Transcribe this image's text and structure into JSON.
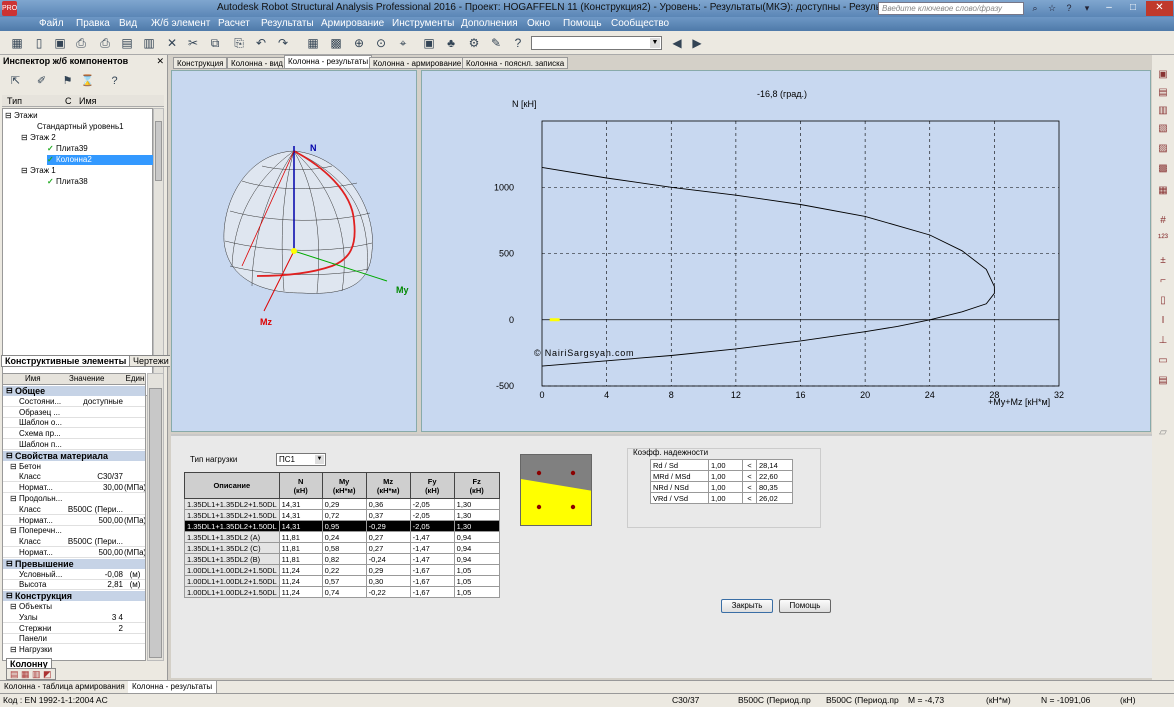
{
  "titlebar": {
    "title": "Autodesk Robot Structural Analysis Professional 2016 - Проект: HOGAFFELN 11 (Конструкция2) - Уровень:  - Результаты(МКЭ): доступны - Результаты: доступные",
    "logo": "PRO",
    "search_placeholder": "Введите ключевое слово/фразу"
  },
  "menu": [
    "Файл",
    "Правка",
    "Вид",
    "Ж/б элемент",
    "Расчет",
    "Результаты",
    "Армирование",
    "Инструменты",
    "Дополнения",
    "Окно",
    "Помощь",
    "Сообщество"
  ],
  "inspector": {
    "title": "Инспектор ж/б компонентов",
    "columns": {
      "type": "Тип",
      "c": "С",
      "name": "Имя"
    },
    "tree": {
      "floors": "Этажи",
      "std_level": "Стандартный уровень1",
      "floor2": "Этаж 2",
      "slab39": "Плита39",
      "column2": "Колонна2",
      "floor1": "Этаж 1",
      "slab38": "Плита38"
    },
    "tabs": {
      "elements": "Конструктивные элементы",
      "drawings": "Чертежи"
    }
  },
  "properties": {
    "columns": {
      "name": "Имя",
      "value": "Значение",
      "unit": "Един"
    },
    "rows": [
      {
        "group": "Общее"
      },
      {
        "name": "Состояни...",
        "value": "доступные",
        "unit": ""
      },
      {
        "name": "Образец ...",
        "value": "",
        "unit": ""
      },
      {
        "name": "Шаблон о...",
        "value": "",
        "unit": ""
      },
      {
        "name": "Схема пр...",
        "value": "",
        "unit": ""
      },
      {
        "name": "Шаблон п...",
        "value": "",
        "unit": ""
      },
      {
        "group": "Свойства материала"
      },
      {
        "sub": "Бетон"
      },
      {
        "name": "Класс",
        "value": "C30/37",
        "unit": ""
      },
      {
        "name": "Нормат...",
        "value": "30,00",
        "unit": "(MПa)"
      },
      {
        "sub": "Продольн..."
      },
      {
        "name": "Класс",
        "value": "B500C (Пери...",
        "unit": ""
      },
      {
        "name": "Нормат...",
        "value": "500,00",
        "unit": "(MПa)"
      },
      {
        "sub": "Поперечн..."
      },
      {
        "name": "Класс",
        "value": "B500C (Пери...",
        "unit": ""
      },
      {
        "name": "Нормат...",
        "value": "500,00",
        "unit": "(MПa)"
      },
      {
        "group": "Превышение"
      },
      {
        "name": "Условный...",
        "value": "-0,08",
        "unit": "(м)"
      },
      {
        "name": "Высота",
        "value": "2,81",
        "unit": "(м)"
      },
      {
        "group": "Конструкция"
      },
      {
        "sub": "Объекты"
      },
      {
        "name": "Узлы",
        "value": "3 4",
        "unit": ""
      },
      {
        "name": "Стержни",
        "value": "2",
        "unit": ""
      },
      {
        "name": "Панели",
        "value": "",
        "unit": ""
      },
      {
        "sub": "Нагрузки"
      }
    ],
    "bottom_tab": "Колонну"
  },
  "doc_tabs": [
    "Конструкция",
    "Колонна - вид",
    "Колонна - результаты",
    "Колонна - армирование",
    "Колонна - пояснл. записка"
  ],
  "view3d": {
    "axis_n": "N",
    "axis_my": "My",
    "axis_mz": "Mz"
  },
  "chart_data": {
    "type": "line",
    "title": "-16,8 (град.)",
    "ylabel": "N [кН]",
    "xlabel": "+My+Mz [кН*м]",
    "xlim": [
      0,
      32
    ],
    "ylim": [
      -500,
      1500
    ],
    "xticks": [
      0,
      4,
      8,
      12,
      16,
      20,
      24,
      28,
      32
    ],
    "yticks": [
      {
        "v": 1000,
        "l": "1000"
      },
      {
        "v": 500,
        "l": "500"
      },
      {
        "v": 0,
        "l": "0"
      },
      {
        "v": -500,
        "l": "-500"
      }
    ],
    "watermark": "© NairiSargsyan.com",
    "series": [
      {
        "x": [
          0,
          4,
          8,
          12,
          16,
          20,
          24,
          26,
          27.5,
          28,
          28,
          27.5,
          26,
          24,
          22,
          20,
          16,
          12,
          8,
          4,
          0
        ],
        "y": [
          1150,
          1070,
          1000,
          940,
          870,
          780,
          640,
          520,
          380,
          250,
          200,
          120,
          60,
          0,
          -50,
          -90,
          -160,
          -220,
          -270,
          -310,
          -350
        ]
      }
    ],
    "point": {
      "x": 0.6,
      "y": 0
    }
  },
  "bottom": {
    "load_type_label": "Тип нагрузки",
    "load_type_value": "ПС1",
    "table_headers": [
      [
        "Описание",
        ""
      ],
      [
        "N",
        "(кН)"
      ],
      [
        "My",
        "(кН*м)"
      ],
      [
        "Mz",
        "(кН*м)"
      ],
      [
        "Fy",
        "(кН)"
      ],
      [
        "Fz",
        "(кН)"
      ]
    ],
    "rows": [
      [
        "1.35DL1+1.35DL2+1.50DL",
        "14,31",
        "0,29",
        "0,36",
        "-2,05",
        "1,30"
      ],
      [
        "1.35DL1+1.35DL2+1.50DL",
        "14,31",
        "0,72",
        "0,37",
        "-2,05",
        "1,30"
      ],
      [
        "1.35DL1+1.35DL2+1.50DL",
        "14,31",
        "0,95",
        "-0,29",
        "-2,05",
        "1,30"
      ],
      [
        "1.35DL1+1.35DL2 (A)",
        "11,81",
        "0,24",
        "0,27",
        "-1,47",
        "0,94"
      ],
      [
        "1.35DL1+1.35DL2 (C)",
        "11,81",
        "0,58",
        "0,27",
        "-1,47",
        "0,94"
      ],
      [
        "1.35DL1+1.35DL2 (B)",
        "11,81",
        "0,82",
        "-0,24",
        "-1,47",
        "0,94"
      ],
      [
        "1.00DL1+1.00DL2+1.50DL",
        "11,24",
        "0,22",
        "0,29",
        "-1,67",
        "1,05"
      ],
      [
        "1.00DL1+1.00DL2+1.50DL",
        "11,24",
        "0,57",
        "0,30",
        "-1,67",
        "1,05"
      ],
      [
        "1.00DL1+1.00DL2+1.50DL",
        "11,24",
        "0,74",
        "-0,22",
        "-1,67",
        "1,05"
      ]
    ],
    "selected_row": 2,
    "coef_title": "Коэфф. надежности",
    "coef": [
      [
        "Rd / Sd",
        "1,00",
        "<",
        "28,14"
      ],
      [
        "MRd / MSd",
        "1,00",
        "<",
        "22,60"
      ],
      [
        "NRd / NSd",
        "1,00",
        "<",
        "80,35"
      ],
      [
        "VRd / VSd",
        "1,00",
        "<",
        "26,02"
      ]
    ],
    "close_btn": "Закрыть",
    "help_btn": "Помощь"
  },
  "windows": [
    "Колонна - таблица армирования",
    "Колонна - результаты"
  ],
  "status": {
    "code": "Код : EN 1992-1-1:2004 AC",
    "concrete": "C30/37",
    "rebar1": "B500C (Период.пр",
    "rebar2": "B500C (Период.пр",
    "moment": "M = -4,73",
    "moment_unit": "(кН*м)",
    "force": "N = -1091,06",
    "force_unit": "(кН)"
  },
  "colors": {
    "title_bar": "#5b86b6",
    "view_bg": "#c8d8f0",
    "selection": "#3399ff",
    "section_top": "#808080",
    "section_bottom": "#ffff00"
  }
}
